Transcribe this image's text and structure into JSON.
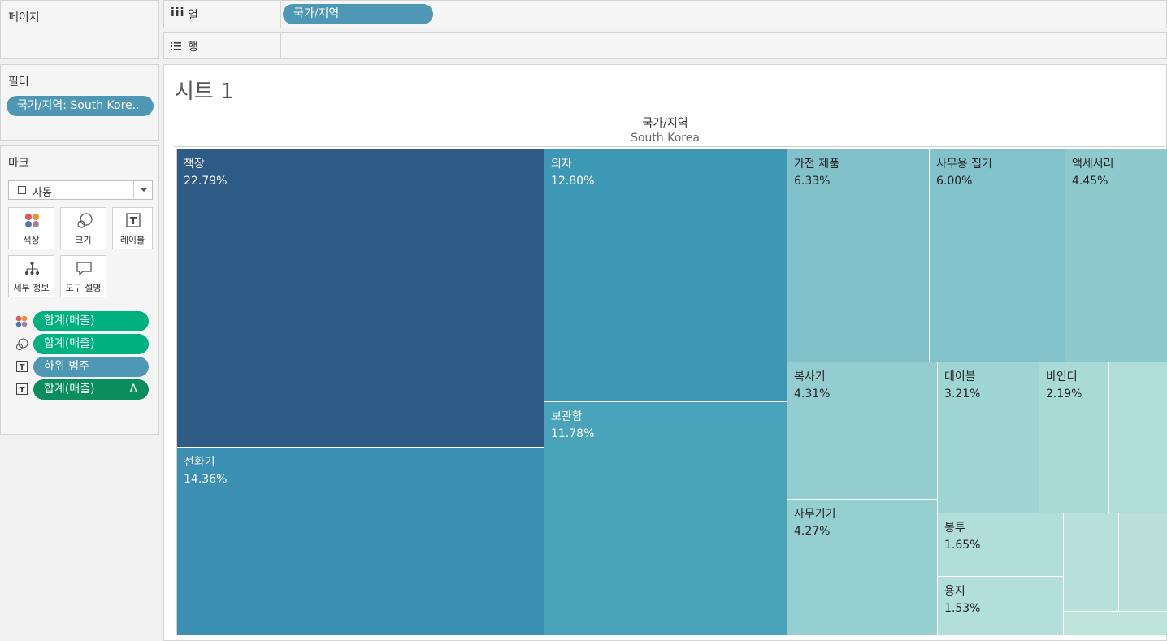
{
  "left_panels": {
    "pages_title": "페이지",
    "filters_title": "필터",
    "filter_pill": "국가/지역: South Kore..",
    "marks_title": "마크",
    "mark_type": "자동",
    "mark_buttons": [
      {
        "label": "색상",
        "icon": "color-dots-icon"
      },
      {
        "label": "크기",
        "icon": "size-circles-icon"
      },
      {
        "label": "레이블",
        "icon": "text-label-icon"
      },
      {
        "label": "세부 정보",
        "icon": "detail-tree-icon"
      },
      {
        "label": "도구 설명",
        "icon": "tooltip-bubble-icon"
      }
    ],
    "mark_fields": [
      {
        "label": "합계(매출)",
        "icon": "color-dots-icon"
      },
      {
        "label": "합계(매출)",
        "icon": "size-circles-icon"
      },
      {
        "label": "하위 범주",
        "icon": "text-label-icon"
      },
      {
        "label": "합계(매출)",
        "icon": "text-label-icon",
        "suffix": "Δ"
      }
    ]
  },
  "shelves": {
    "columns_label": "열",
    "columns_icon": "iii",
    "columns_pill": "국가/지역",
    "rows_label": "행",
    "rows_icon": "list-icon"
  },
  "sheet": {
    "title": "시트 1",
    "header_field": "국가/지역",
    "header_value": "South Korea"
  },
  "colors": {
    "pill_blue": "#4e98b5",
    "pill_green": "#00b180",
    "pill_dark_green": "#0a8e5e"
  },
  "chart_data": {
    "type": "treemap",
    "subcategories": [
      {
        "name": "책장",
        "percent": "22.79%",
        "color": "#2e5a86"
      },
      {
        "name": "전화기",
        "percent": "14.36%",
        "color": "#3a8fb3"
      },
      {
        "name": "의자",
        "percent": "12.80%",
        "color": "#3d98b5"
      },
      {
        "name": "보관함",
        "percent": "11.78%",
        "color": "#48a3bb"
      },
      {
        "name": "가전 제품",
        "percent": "6.33%",
        "color": "#80c1ca"
      },
      {
        "name": "사무용 집기",
        "percent": "6.00%",
        "color": "#82c3cb"
      },
      {
        "name": "액세서리",
        "percent": "4.45%",
        "color": "#8ecacd"
      },
      {
        "name": "복사기",
        "percent": "4.31%",
        "color": "#93cdcf"
      },
      {
        "name": "사무기기",
        "percent": "4.27%",
        "color": "#95cfd0"
      },
      {
        "name": "테이블",
        "percent": "3.21%",
        "color": "#9fd5d3"
      },
      {
        "name": "바인더",
        "percent": "2.19%",
        "color": "#a9dad6"
      },
      {
        "name": "봉투",
        "percent": "1.65%",
        "color": "#b1ded9"
      },
      {
        "name": "용지",
        "percent": "1.53%",
        "color": "#b2dfd9"
      },
      {
        "name": "",
        "percent": "",
        "color": "#b1ddd8"
      },
      {
        "name": "",
        "percent": "",
        "color": "#b6e0d9"
      },
      {
        "name": "",
        "percent": "",
        "color": "#badfd8"
      },
      {
        "name": "",
        "percent": "",
        "color": "#bde3da"
      }
    ]
  }
}
